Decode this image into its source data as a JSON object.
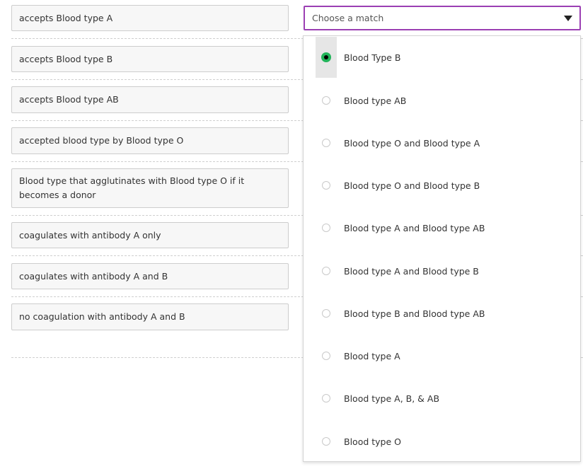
{
  "prompts": [
    {
      "text": "accepts Blood type A"
    },
    {
      "text": "accepts Blood type B"
    },
    {
      "text": "accepts Blood type AB"
    },
    {
      "text": "accepted blood type by Blood type O"
    },
    {
      "text": "Blood type that agglutinates with Blood type O if it becomes a donor"
    },
    {
      "text": "coagulates with antibody A only"
    },
    {
      "text": "coagulates with antibody A and B"
    },
    {
      "text": "no coagulation with antibody A and B"
    }
  ],
  "select": {
    "placeholder": "Choose a match",
    "caret_icon": "caret-down-icon",
    "accent_color": "#9b3fb3"
  },
  "dropdown": {
    "selected_index": 0,
    "checked_color": "#22b45a",
    "options": [
      {
        "label": "Blood Type B"
      },
      {
        "label": "Blood type AB"
      },
      {
        "label": "Blood type O and Blood type A"
      },
      {
        "label": "Blood type O and Blood type B"
      },
      {
        "label": "Blood type A and Blood type AB"
      },
      {
        "label": "Blood type A and Blood type B"
      },
      {
        "label": "Blood type B and Blood type AB"
      },
      {
        "label": "Blood type A"
      },
      {
        "label": "Blood type A, B, & AB"
      },
      {
        "label": "Blood type O"
      }
    ]
  }
}
